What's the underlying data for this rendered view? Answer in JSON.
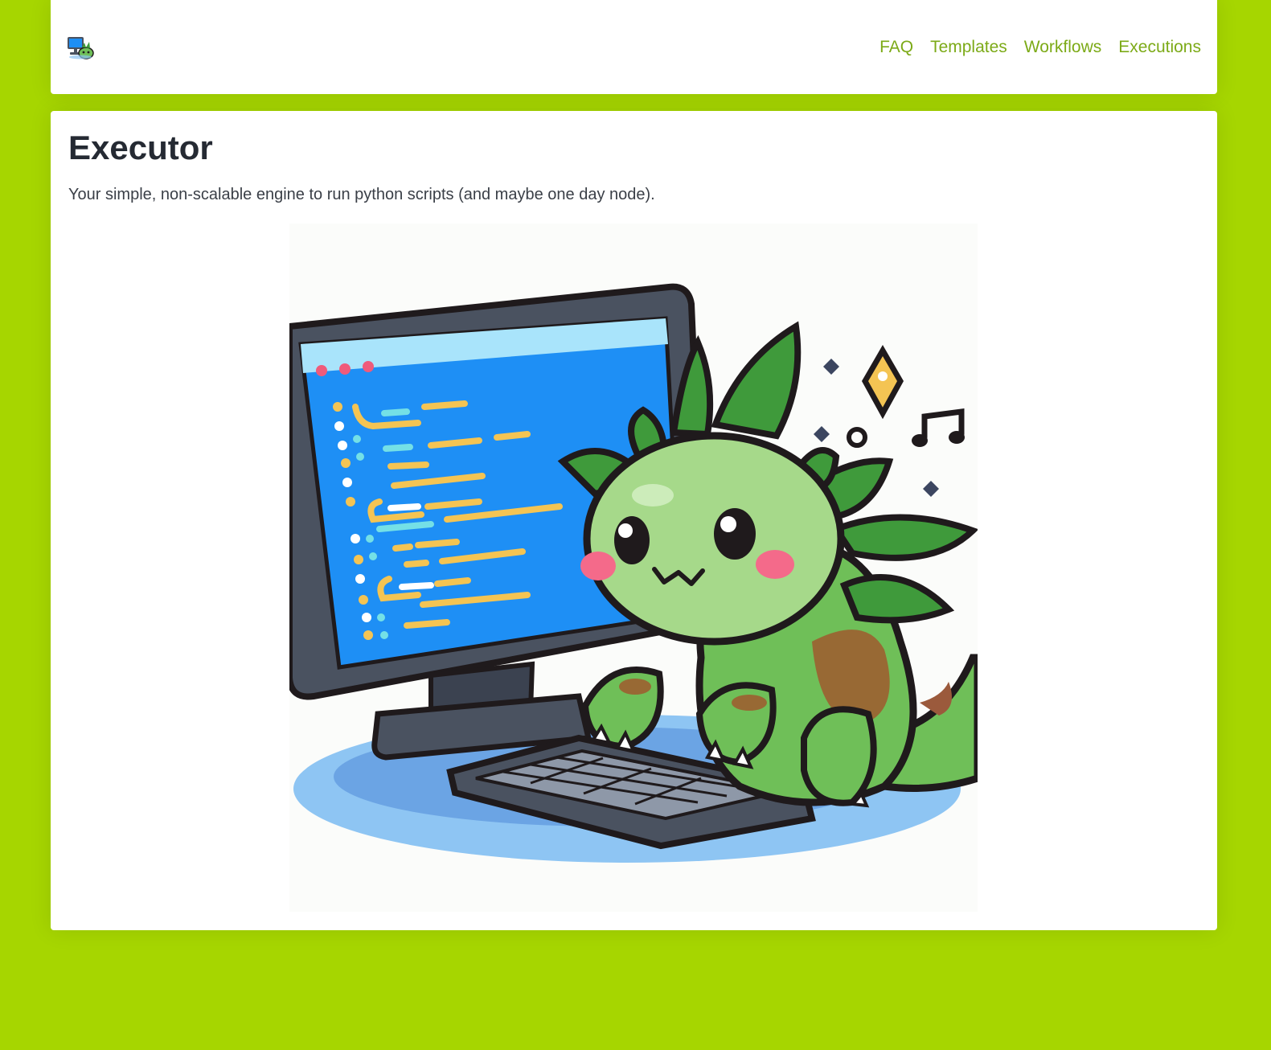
{
  "nav": {
    "logo_icon": "mascot-computer-icon",
    "links": [
      {
        "label": "FAQ"
      },
      {
        "label": "Templates"
      },
      {
        "label": "Workflows"
      },
      {
        "label": "Executions"
      }
    ]
  },
  "main": {
    "title": "Executor",
    "subtitle": "Your simple, non-scalable engine to run python scripts (and maybe one day node)."
  },
  "hero_image": {
    "subject": "dinosaur-mascot-typing-on-computer"
  },
  "colors": {
    "background": "#a6d600",
    "link": "#7caa17",
    "title": "#252a33",
    "card": "#ffffff"
  }
}
